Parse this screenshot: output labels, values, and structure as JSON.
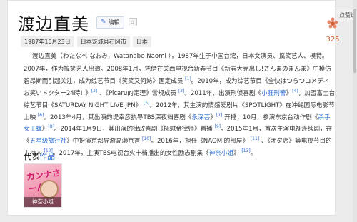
{
  "header": {
    "title": "渡边直美",
    "edit_label": "编辑",
    "mini_icon": "square-icon"
  },
  "tags": [
    "1987年10月23日",
    "日本茨城县石冈市",
    "日本"
  ],
  "like": {
    "count": "325",
    "tooltip": "点赞送祝"
  },
  "intro": "渡边直美（わたなべ なおみ，Watanabe Naomi ），1987年生于中国台湾，日本女演员、搞笑艺人、模特。",
  "paragraph": [
    {
      "t": "2007年，作为搞笑艺人出道。2008年1月，凭借在关西电视台新春节目《新春大売出し!さんまのまんま》中模仿碧昂斯而引起关注，成为综艺节目《笑笑又何妨》固定成员 "
    },
    {
      "s": "[1]"
    },
    {
      "t": "。2010年，成为综艺节目《全快はつらつコメディ お笑いドクター24時!!》"
    },
    {
      "s": "[2]"
    },
    {
      "t": " 、《Picaru的定理》常规成员 "
    },
    {
      "s": "[3]"
    },
    {
      "t": "。2011年，出演刑侦喜剧《"
    },
    {
      "l": "小狂刑警"
    },
    {
      "t": "》"
    },
    {
      "s": "[4]"
    },
    {
      "t": "，加盟富士台综艺节目《SATURDAY NIGHT LIVE JPN》 "
    },
    {
      "s": "[5]"
    },
    {
      "t": "。2012年，其主演的情感爱剧片《SPOTLIGHT》在冲绳国际电影节上映 "
    },
    {
      "s": "[6]"
    },
    {
      "t": "。2013年4月，其出演的堤幸彦执导TBS深夜档喜剧《"
    },
    {
      "l": "永深菩"
    },
    {
      "t": "》"
    },
    {
      "s": "[7]"
    },
    {
      "t": " 开播；10月，参演东京台动作剧《"
    },
    {
      "l": "杀手女王蜂"
    },
    {
      "t": "》"
    },
    {
      "s": "[8]"
    },
    {
      "t": "。2014年1月9日，其出演的律政喜剧《抚慰金律师》首播 "
    },
    {
      "s": "[9]"
    },
    {
      "t": "。2015年1月，首次主演电视连续剧，在《"
    },
    {
      "l": "五星级旅行社"
    },
    {
      "t": "》中扮演京都导游高濑京香 "
    },
    {
      "s": "[10]"
    },
    {
      "t": "。2016年，担任《NAOMI的部屋》 "
    },
    {
      "s": "[11]"
    },
    {
      "t": " 、《オタ恋》等电视节目的主持人 "
    },
    {
      "s": "[12]"
    },
    {
      "t": "。2017年，主演TBS电视台火十档播出的女性励志剧集《"
    },
    {
      "l": "神奈小姐"
    },
    {
      "t": "》 "
    },
    {
      "s": "[13]"
    },
    {
      "t": "。"
    }
  ],
  "section": {
    "title_a": "代表",
    "title_b": "作品"
  },
  "work": {
    "caption": "神奈小姐",
    "poster_text": "カンナさーん!"
  },
  "colors": {
    "link": "#2f6fd0",
    "accent": "#d0653a"
  }
}
